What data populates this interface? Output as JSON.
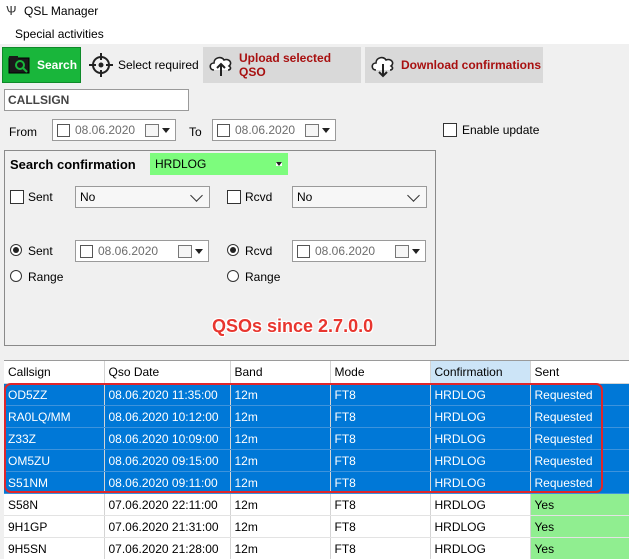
{
  "window": {
    "title": "QSL Manager"
  },
  "menu": {
    "items": [
      "Special activities"
    ]
  },
  "toolbar": {
    "search_label": "Search",
    "select_label": "Select required",
    "upload_label": "Upload selected QSO",
    "download_label": "Download confirmations"
  },
  "filters": {
    "callsign_value": "CALLSIGN",
    "from_label": "From",
    "from_date": "08.06.2020",
    "to_label": "To",
    "to_date": "08.06.2020",
    "enable_update_label": "Enable update"
  },
  "search_confirmation": {
    "label": "Search confirmation",
    "source": "HRDLOG",
    "sent_label": "Sent",
    "sent_value": "No",
    "rcvd_label": "Rcvd",
    "rcvd_value": "No",
    "sent_radio_label": "Sent",
    "sent_date": "08.06.2020",
    "rcvd_radio_label": "Rcvd",
    "rcvd_date": "08.06.2020",
    "range_label_left": "Range",
    "range_label_right": "Range"
  },
  "annotation": "QSOs since 2.7.0.0",
  "colors": {
    "selected_row": "#0078d7",
    "sent_yes": "#90ee90",
    "search_button": "#19b63b",
    "source_field": "#7dfc7d",
    "annotation": "#e8362f"
  },
  "table": {
    "columns": [
      "Callsign",
      "Qso Date",
      "Band",
      "Mode",
      "Confirmation",
      "Sent"
    ],
    "rows": [
      {
        "callsign": "OD5ZZ",
        "date": "08.06.2020 11:35:00",
        "band": "12m",
        "mode": "FT8",
        "confirmation": "HRDLOG",
        "sent": "Requested",
        "selected": true
      },
      {
        "callsign": "RA0LQ/MM",
        "date": "08.06.2020 10:12:00",
        "band": "12m",
        "mode": "FT8",
        "confirmation": "HRDLOG",
        "sent": "Requested",
        "selected": true
      },
      {
        "callsign": "Z33Z",
        "date": "08.06.2020 10:09:00",
        "band": "12m",
        "mode": "FT8",
        "confirmation": "HRDLOG",
        "sent": "Requested",
        "selected": true
      },
      {
        "callsign": "OM5ZU",
        "date": "08.06.2020 09:15:00",
        "band": "12m",
        "mode": "FT8",
        "confirmation": "HRDLOG",
        "sent": "Requested",
        "selected": true
      },
      {
        "callsign": "S51NM",
        "date": "08.06.2020 09:11:00",
        "band": "12m",
        "mode": "FT8",
        "confirmation": "HRDLOG",
        "sent": "Requested",
        "selected": true
      },
      {
        "callsign": "S58N",
        "date": "07.06.2020 22:11:00",
        "band": "12m",
        "mode": "FT8",
        "confirmation": "HRDLOG",
        "sent": "Yes",
        "selected": false
      },
      {
        "callsign": "9H1GP",
        "date": "07.06.2020 21:31:00",
        "band": "12m",
        "mode": "FT8",
        "confirmation": "HRDLOG",
        "sent": "Yes",
        "selected": false
      },
      {
        "callsign": "9H5SN",
        "date": "07.06.2020 21:28:00",
        "band": "12m",
        "mode": "FT8",
        "confirmation": "HRDLOG",
        "sent": "Yes",
        "selected": false
      }
    ]
  }
}
